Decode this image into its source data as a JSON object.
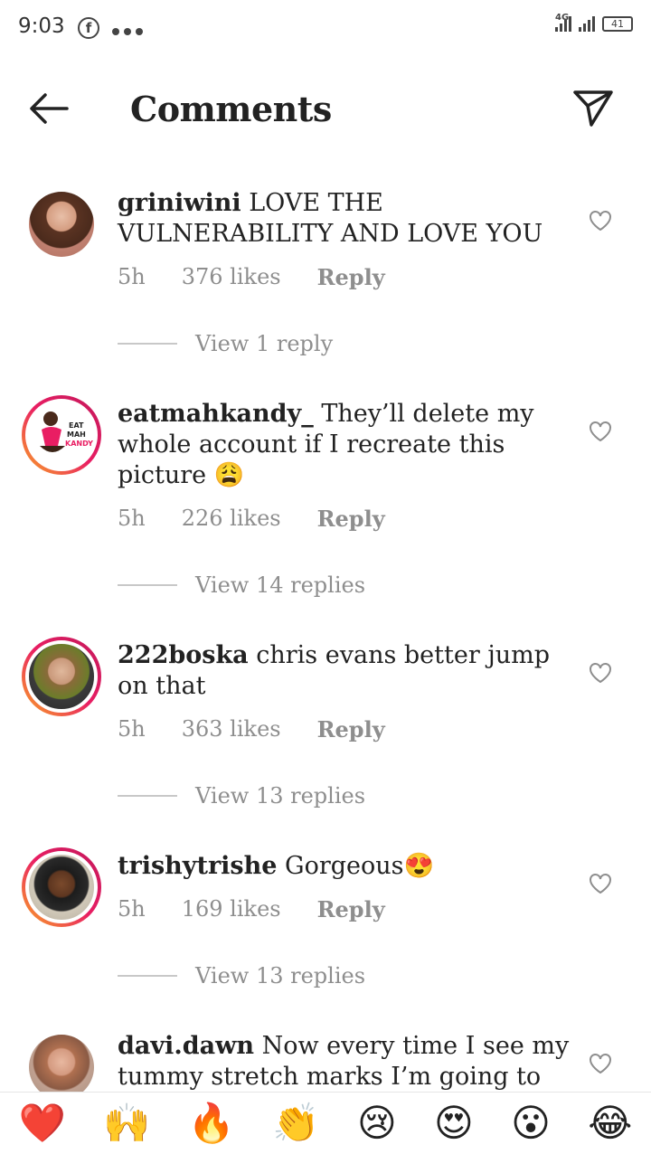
{
  "status": {
    "time": "9:03",
    "network": "4G",
    "battery": "41"
  },
  "header": {
    "title": "Comments"
  },
  "comments": [
    {
      "username": "griniwini",
      "text": "LOVE THE VULNERABILITY AND LOVE YOU",
      "time": "5h",
      "likes": "376 likes",
      "reply": "Reply",
      "view": "View 1 reply"
    },
    {
      "username": "eatmahkandy_",
      "text": "They’ll delete my whole account if I recreate this picture 😩",
      "time": "5h",
      "likes": "226 likes",
      "reply": "Reply",
      "view": "View 14 replies",
      "avatar_text": "EAT MAH KANDY"
    },
    {
      "username": "222boska",
      "text": "chris evans better jump on that",
      "time": "5h",
      "likes": "363 likes",
      "reply": "Reply",
      "view": "View 13 replies"
    },
    {
      "username": "trishytrishe",
      "text": "Gorgeous😍",
      "time": "5h",
      "likes": "169 likes",
      "reply": "Reply",
      "view": "View 13 replies"
    },
    {
      "username": "davi.dawn",
      "text": "Now every time I see my tummy stretch marks I’m going to"
    }
  ],
  "reactions": [
    "❤️",
    "🙌",
    "🔥",
    "👏",
    "😢",
    "😍",
    "😮",
    "😂"
  ]
}
